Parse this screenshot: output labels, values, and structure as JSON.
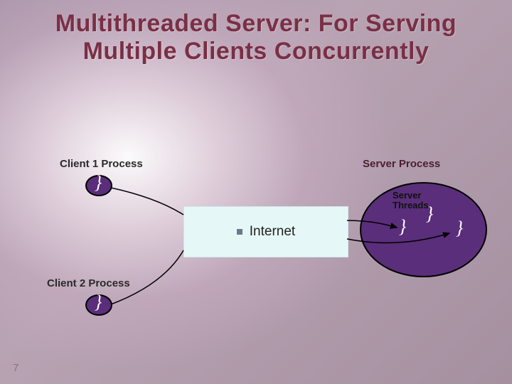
{
  "title_line1": "Multithreaded Server: For Serving",
  "title_line2": "Multiple Clients Concurrently",
  "labels": {
    "client1": "Client 1 Process",
    "client2": "Client 2 Process",
    "server_process": "Server Process",
    "server_threads": "Server\nThreads",
    "internet": "Internet"
  },
  "page_number": "7",
  "colors": {
    "title": "#7a2f45",
    "ellipse_fill": "#5a2e7a",
    "internet_box": "#e6f7f7"
  }
}
